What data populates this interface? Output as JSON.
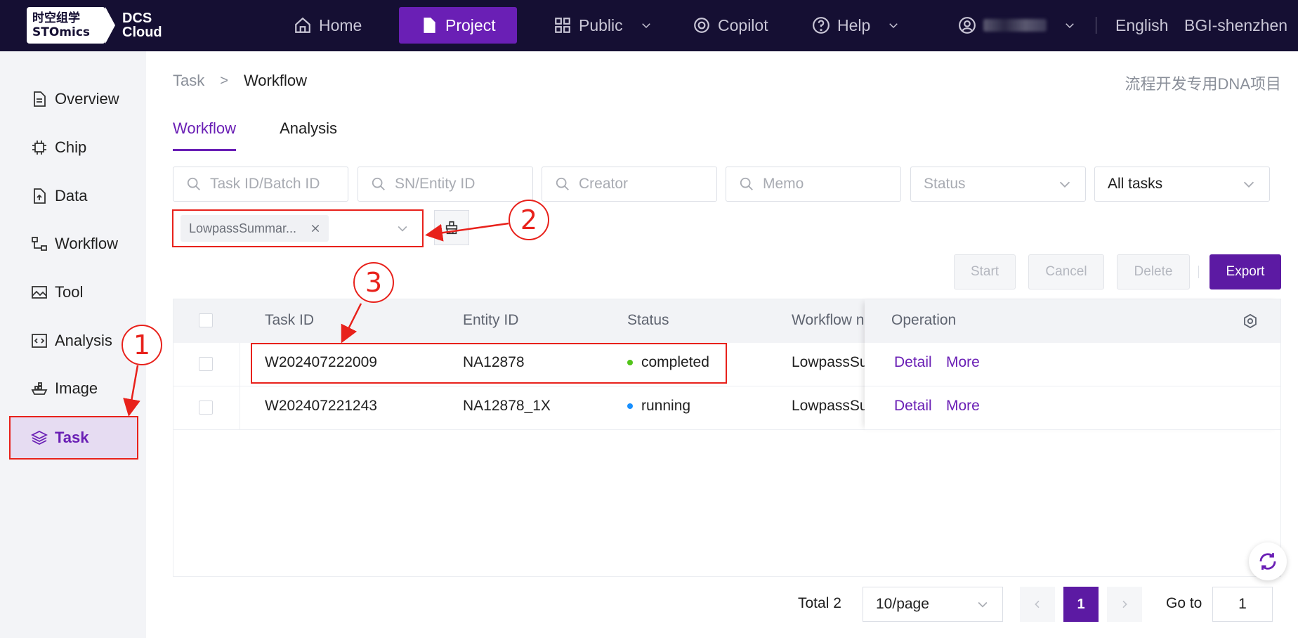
{
  "logo": {
    "line1": "时空组学",
    "line2": "STOmics",
    "dcs1": "DCS",
    "dcs2": "Cloud"
  },
  "nav": {
    "home": "Home",
    "project": "Project",
    "public": "Public",
    "copilot": "Copilot",
    "help": "Help",
    "language": "English",
    "org": "BGI-shenzhen"
  },
  "sidebar": {
    "items": [
      "Overview",
      "Chip",
      "Data",
      "Workflow",
      "Tool",
      "Analysis",
      "Image",
      "Task"
    ]
  },
  "breadcrumb": {
    "parent": "Task",
    "sep": ">",
    "current": "Workflow"
  },
  "project_name": "流程开发专用DNA项目",
  "tabs": [
    "Workflow",
    "Analysis"
  ],
  "filters": {
    "task_id": "Task ID/Batch ID",
    "sn": "SN/Entity ID",
    "creator": "Creator",
    "memo": "Memo",
    "status": "Status",
    "scope": "All tasks"
  },
  "workflow_tag": "LowpassSummar...",
  "buttons": {
    "start": "Start",
    "cancel": "Cancel",
    "delete": "Delete",
    "export": "Export"
  },
  "table": {
    "headers": [
      "Task ID",
      "Entity ID",
      "Status",
      "Workflow n",
      "Operation"
    ],
    "rows": [
      {
        "task_id": "W202407222009",
        "entity_id": "NA12878",
        "status": "completed",
        "workflow": "LowpassSu",
        "detail": "Detail",
        "more": "More"
      },
      {
        "task_id": "W202407221243",
        "entity_id": "NA12878_1X",
        "status": "running",
        "workflow": "LowpassSu",
        "detail": "Detail",
        "more": "More"
      }
    ]
  },
  "pagination": {
    "total": "Total 2",
    "page_size": "10/page",
    "current": "1",
    "goto_label": "Go to",
    "goto_value": "1"
  },
  "annotations": [
    "1",
    "2",
    "3"
  ],
  "colors": {
    "brand": "#6a1fb5",
    "nav_bg": "#150f33",
    "annotation": "#e8211b",
    "completed": "#52c41a",
    "running": "#1890ff"
  }
}
